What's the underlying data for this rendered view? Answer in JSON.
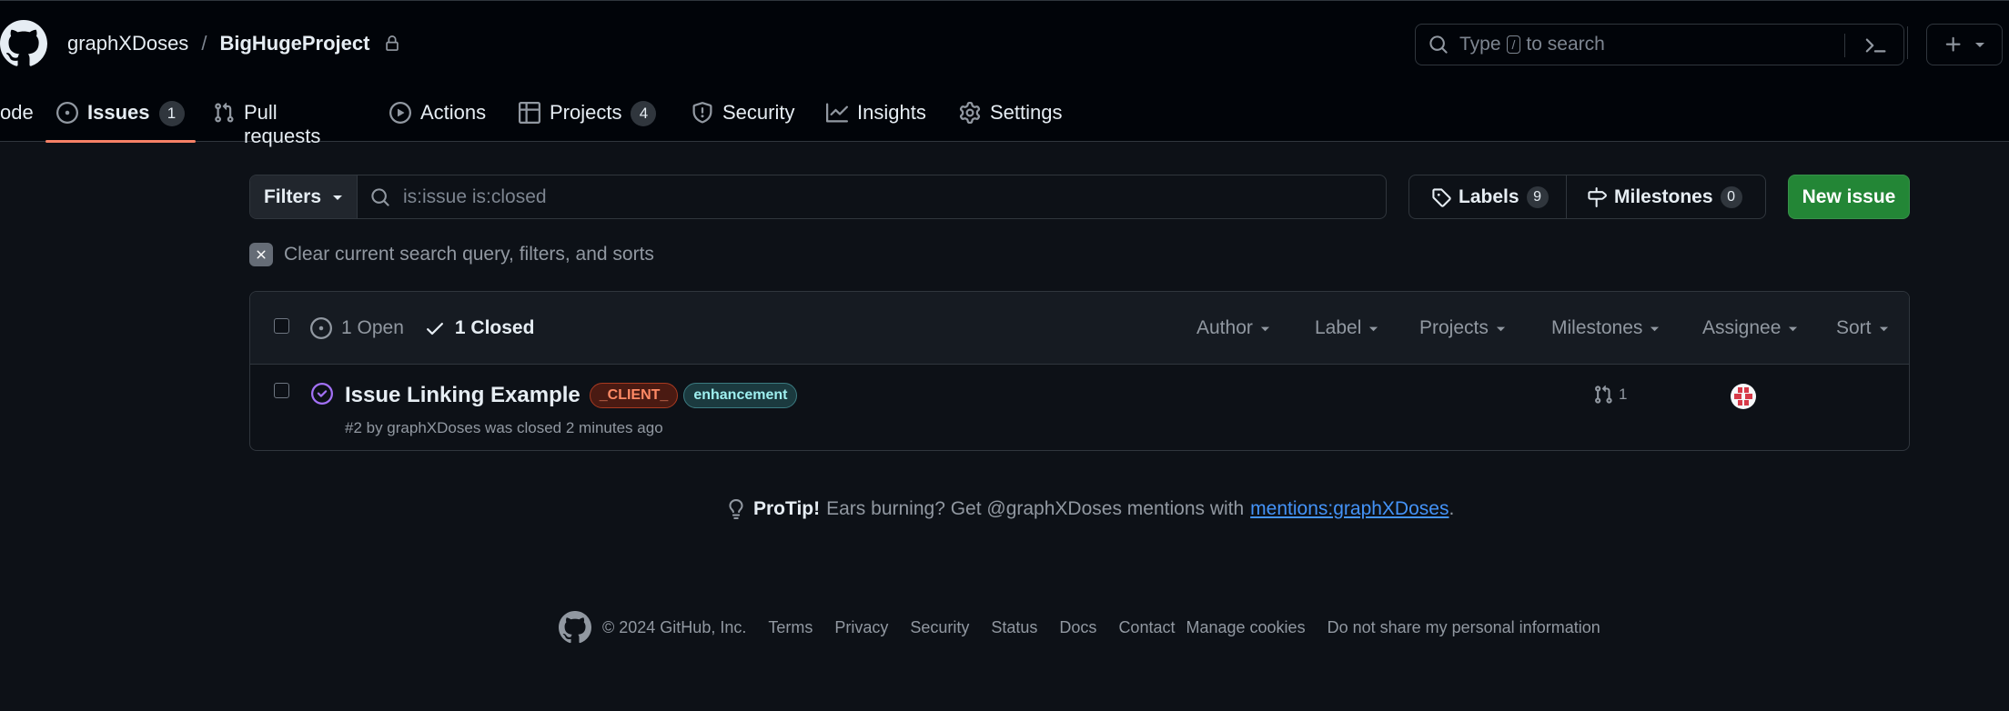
{
  "header": {
    "owner": "graphXDoses",
    "separator": "/",
    "repo": "BigHugeProject",
    "search": {
      "prefix": "Type",
      "key": "/",
      "suffix": "to search"
    }
  },
  "nav": {
    "code": "ode",
    "issues": {
      "label": "Issues",
      "count": "1"
    },
    "pulls": "Pull requests",
    "actions": "Actions",
    "projects": {
      "label": "Projects",
      "count": "4"
    },
    "security": "Security",
    "insights": "Insights",
    "settings": "Settings"
  },
  "toolbar": {
    "filters_label": "Filters",
    "query": "is:issue is:closed",
    "labels": {
      "label": "Labels",
      "count": "9"
    },
    "milestones": {
      "label": "Milestones",
      "count": "0"
    },
    "new_issue": "New issue",
    "clear_query": "Clear current search query, filters, and sorts"
  },
  "list": {
    "open": "1 Open",
    "closed": "1 Closed",
    "filters": [
      "Author",
      "Label",
      "Projects",
      "Milestones",
      "Assignee",
      "Sort"
    ],
    "issues": [
      {
        "title": "Issue Linking Example",
        "labels": [
          {
            "name": "_CLIENT_",
            "color": "#ff8a65"
          },
          {
            "name": "enhancement",
            "color": "#9ff0f0"
          }
        ],
        "meta": "#2 by graphXDoses was closed 2 minutes ago",
        "linked_prs": "1"
      }
    ]
  },
  "protip": {
    "strong": "ProTip!",
    "text": "Ears burning? Get @graphXDoses mentions with",
    "link": "mentions:graphXDoses",
    "end": "."
  },
  "footer": {
    "copyright": "© 2024 GitHub, Inc.",
    "links": [
      "Terms",
      "Privacy",
      "Security",
      "Status",
      "Docs",
      "Contact",
      "Manage cookies",
      "Do not share my personal information"
    ]
  },
  "colors": {
    "background": "#0d1117",
    "header": "#010409",
    "accent_underline": "#f78166",
    "primary_button": "#238636",
    "closed_icon": "#a371f7",
    "link": "#4493f8"
  }
}
